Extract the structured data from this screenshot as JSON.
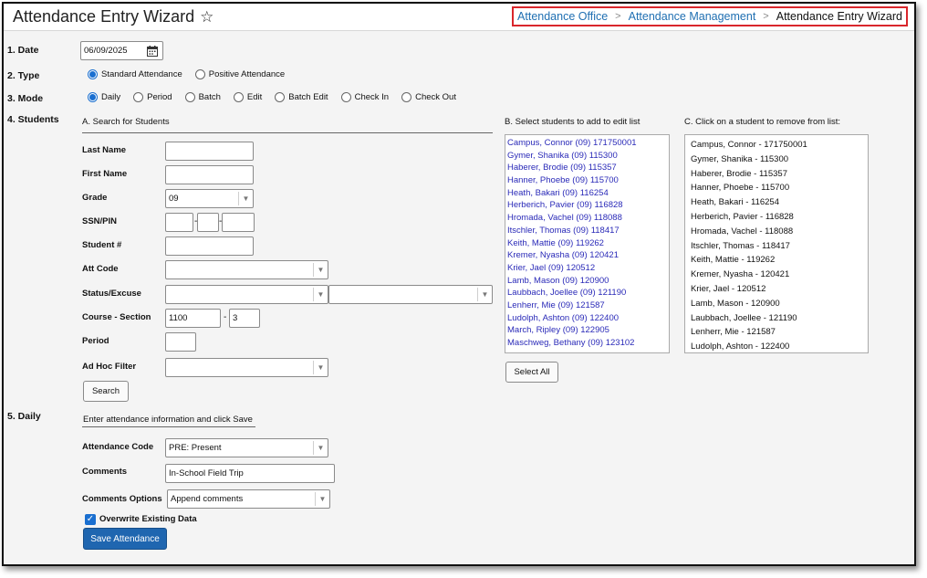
{
  "header": {
    "title": "Attendance Entry Wizard",
    "breadcrumb": [
      "Attendance Office",
      "Attendance Management",
      "Attendance Entry Wizard"
    ]
  },
  "sections": {
    "date": "1. Date",
    "type": "2. Type",
    "mode": "3. Mode",
    "students": "4. Students",
    "daily": "5. Daily"
  },
  "date_value": "06/09/2025",
  "type_options": [
    "Standard Attendance",
    "Positive Attendance"
  ],
  "type_selected": "Standard Attendance",
  "mode_options": [
    "Daily",
    "Period",
    "Batch",
    "Edit",
    "Batch Edit",
    "Check In",
    "Check Out"
  ],
  "mode_selected": "Daily",
  "search": {
    "heading": "A. Search for Students",
    "last_name_label": "Last Name",
    "first_name_label": "First Name",
    "grade_label": "Grade",
    "grade_value": "09",
    "ssn_label": "SSN/PIN",
    "ssn_sep": "-",
    "student_num_label": "Student #",
    "att_code_label": "Att Code",
    "status_label": "Status/Excuse",
    "course_label": "Course - Section",
    "course_value": "1100",
    "section_sep": "-",
    "section_value": "3",
    "period_label": "Period",
    "adhoc_label": "Ad Hoc Filter",
    "search_button": "Search"
  },
  "list_b": {
    "heading": "B. Select students to add to edit list",
    "items": [
      "Campus, Connor (09) 171750001",
      "Gymer, Shanika (09) 115300",
      "Haberer, Brodie (09) 115357",
      "Hanner, Phoebe (09) 115700",
      "Heath, Bakari (09) 116254",
      "Herberich, Pavier (09) 116828",
      "Hromada, Vachel (09) 118088",
      "Itschler, Thomas (09) 118417",
      "Keith, Mattie (09) 119262",
      "Kremer, Nyasha (09) 120421",
      "Krier, Jael (09) 120512",
      "Lamb, Mason (09) 120900",
      "Laubbach, Joellee (09) 121190",
      "Lenherr, Mie (09) 121587",
      "Ludolph, Ashton (09) 122400",
      "March, Ripley (09) 122905",
      "Maschweg, Bethany (09) 123102"
    ],
    "select_all": "Select All"
  },
  "list_c": {
    "heading": "C. Click on a student to remove from list:",
    "items": [
      "Campus, Connor - 171750001",
      "Gymer, Shanika - 115300",
      "Haberer, Brodie - 115357",
      "Hanner, Phoebe - 115700",
      "Heath, Bakari - 116254",
      "Herberich, Pavier - 116828",
      "Hromada, Vachel - 118088",
      "Itschler, Thomas - 118417",
      "Keith, Mattie - 119262",
      "Kremer, Nyasha - 120421",
      "Krier, Jael - 120512",
      "Lamb, Mason - 120900",
      "Laubbach, Joellee - 121190",
      "Lenherr, Mie - 121587",
      "Ludolph, Ashton - 122400"
    ]
  },
  "daily": {
    "instruction": "Enter attendance information and click Save",
    "attendance_code_label": "Attendance Code",
    "attendance_code_value": "PRE: Present",
    "comments_label": "Comments",
    "comments_value": "In-School Field Trip",
    "comments_options_label": "Comments Options",
    "comments_options_value": "Append comments",
    "overwrite_label": "Overwrite Existing Data",
    "overwrite_checked": true,
    "save_button": "Save Attendance"
  },
  "icons": {
    "star": "star-outline-icon",
    "calendar": "calendar-icon",
    "breadcrumb_sep": "chevron-right-icon",
    "dropdown": "chevron-down-icon",
    "checkbox": "checkmark-icon"
  },
  "colors": {
    "link": "#1f6fb2",
    "student_list": "#2a2ab8",
    "primary_button": "#1f66b0",
    "highlight_border": "#d9262c",
    "radio": "#1a6fd0"
  }
}
